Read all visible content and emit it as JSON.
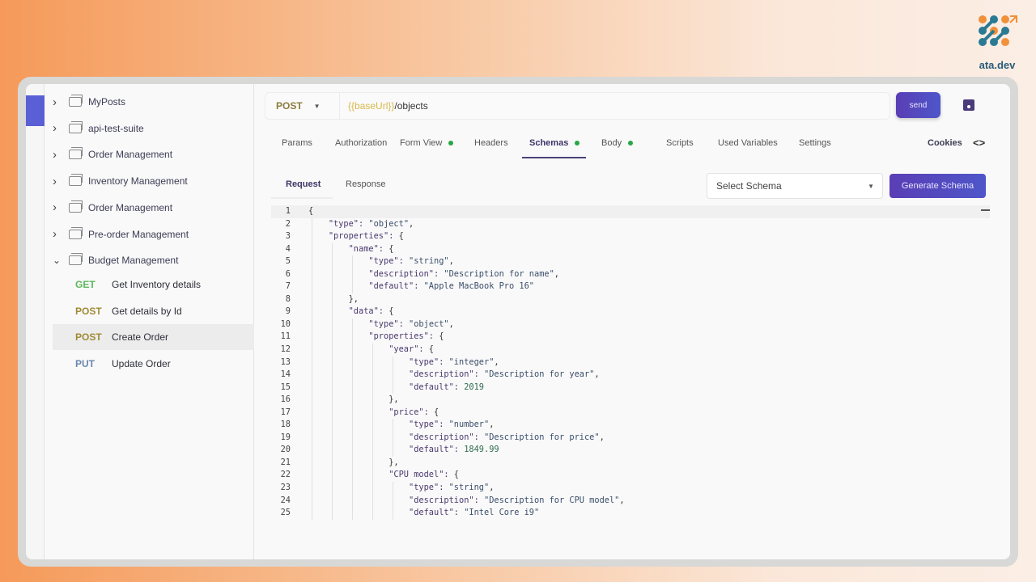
{
  "brand": {
    "name": "ata.dev"
  },
  "sidebar": {
    "folders": [
      {
        "label": "MyPosts",
        "expanded": false
      },
      {
        "label": "api-test-suite",
        "expanded": false
      },
      {
        "label": "Order Management",
        "expanded": false
      },
      {
        "label": "Inventory Management",
        "expanded": false
      },
      {
        "label": "Order Management",
        "expanded": false
      },
      {
        "label": "Pre-order Management",
        "expanded": false
      },
      {
        "label": "Budget Management",
        "expanded": true
      }
    ],
    "requests": [
      {
        "method": "GET",
        "label": "Get Inventory details",
        "color": "#5cb85c"
      },
      {
        "method": "POST",
        "label": "Get details by Id",
        "color": "#a08a35"
      },
      {
        "method": "POST",
        "label": "Create Order",
        "color": "#a08a35",
        "selected": true
      },
      {
        "method": "PUT",
        "label": "Update Order",
        "color": "#6a86b0"
      }
    ]
  },
  "request": {
    "method": "POST",
    "url_variable": "{{baseUrl}}",
    "url_path": "/objects",
    "send_label": "send"
  },
  "tabs": [
    {
      "label": "Params"
    },
    {
      "label": "Authorization"
    },
    {
      "label": "Form View",
      "dot": true
    },
    {
      "label": "Headers"
    },
    {
      "label": "Schemas",
      "dot": true,
      "active": true
    },
    {
      "label": "Body",
      "dot": true
    },
    {
      "label": "Scripts"
    },
    {
      "label": "Used Variables"
    },
    {
      "label": "Settings"
    }
  ],
  "cookies_label": "Cookies",
  "code_toggle": "<>",
  "schema": {
    "subtabs": [
      "Request",
      "Response"
    ],
    "active_subtab": "Request",
    "select_placeholder": "Select Schema",
    "generate_label": "Generate Schema",
    "lines": [
      "{",
      "    \"type\": \"object\",",
      "    \"properties\": {",
      "        \"name\": {",
      "            \"type\": \"string\",",
      "            \"description\": \"Description for name\",",
      "            \"default\": \"Apple MacBook Pro 16\"",
      "        },",
      "        \"data\": {",
      "            \"type\": \"object\",",
      "            \"properties\": {",
      "                \"year\": {",
      "                    \"type\": \"integer\",",
      "                    \"description\": \"Description for year\",",
      "                    \"default\": 2019",
      "                },",
      "                \"price\": {",
      "                    \"type\": \"number\",",
      "                    \"description\": \"Description for price\",",
      "                    \"default\": 1849.99",
      "                },",
      "                \"CPU model\": {",
      "                    \"type\": \"string\",",
      "                    \"description\": \"Description for CPU model\",",
      "                    \"default\": \"Intel Core i9\""
    ]
  }
}
